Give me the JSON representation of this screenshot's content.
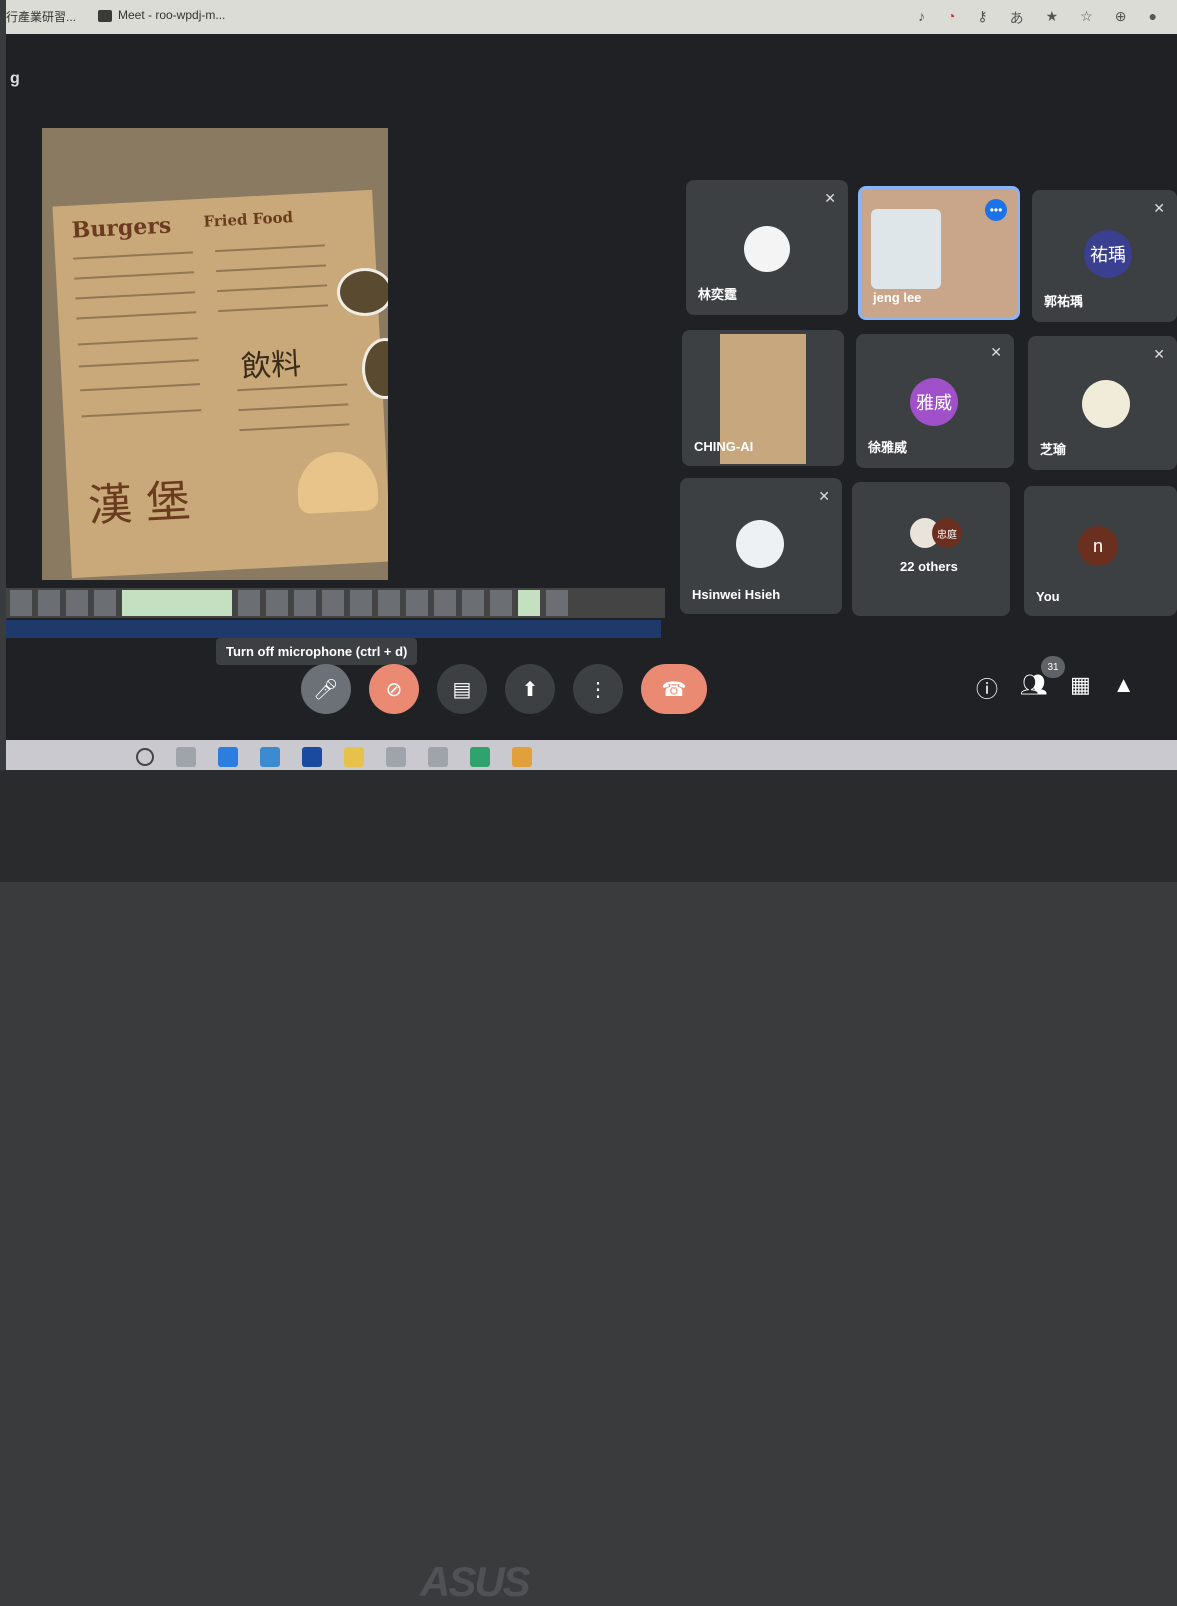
{
  "browser": {
    "tab_1": "行產業研習...",
    "tab_2": "Meet - roo-wpdj-m..."
  },
  "page_letter": "g",
  "presentation": {
    "menu": {
      "title_1": "Burgers",
      "title_2": "Fried Food",
      "drinks": "飲料",
      "big_chars": "漢 堡"
    }
  },
  "tooltip": "Turn off microphone (ctrl + d)",
  "participants": [
    {
      "name": "林奕霆",
      "avatar_text": ""
    },
    {
      "name": "jeng lee",
      "avatar_text": ""
    },
    {
      "name": "郭祐瑀",
      "avatar_text": "祐瑀"
    },
    {
      "name": "CHING-AI",
      "avatar_text": ""
    },
    {
      "name": "徐雅威",
      "avatar_text": "雅威"
    },
    {
      "name": "芝瑜",
      "avatar_text": ""
    },
    {
      "name": "Hsinwei Hsieh",
      "avatar_text": ""
    },
    {
      "name": "22 others",
      "avatar_text": "忠庭"
    },
    {
      "name": "You",
      "avatar_text": "n"
    }
  ],
  "people_count": "31",
  "colors": {
    "accent_blue": "#8ab4f8",
    "end_call": "#ea8a72",
    "tile": "#3c4043",
    "avatar_purple": "#a050c8",
    "avatar_indigo": "#3b3f8f",
    "avatar_brown": "#6b2f20"
  },
  "laptop_brand": "ASUS"
}
